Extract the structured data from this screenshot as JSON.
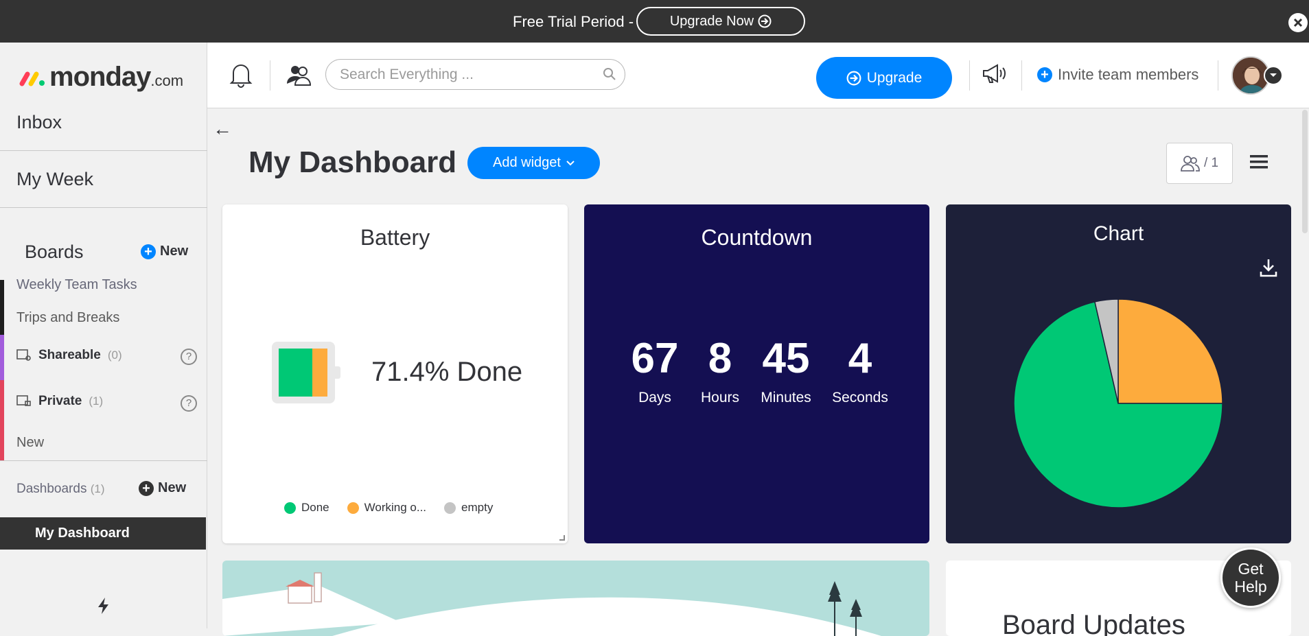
{
  "banner": {
    "text": "Free Trial Period -",
    "upgrade_now_label": "Upgrade Now"
  },
  "sidebar": {
    "logo_text": "monday",
    "logo_suffix": ".com",
    "nav": [
      {
        "label": "Inbox"
      },
      {
        "label": "My Week"
      }
    ],
    "boards_heading": "Boards",
    "boards_new_label": "New",
    "boards": [
      {
        "label": "Weekly Team Tasks"
      },
      {
        "label": "Trips and Breaks"
      }
    ],
    "groups": [
      {
        "label": "Shareable",
        "count": "(0)",
        "help": "?"
      },
      {
        "label": "Private",
        "count": "(1)",
        "help": "?"
      }
    ],
    "new_item_label": "New",
    "dashboards_heading": "Dashboards",
    "dashboards_count": "(1)",
    "dashboards_new_label": "New",
    "dashboards": [
      {
        "label": "My Dashboard"
      }
    ]
  },
  "header": {
    "search_placeholder": "Search Everything ...",
    "upgrade_label": "Upgrade",
    "invite_label": "Invite team members"
  },
  "page": {
    "back_arrow": "←",
    "title": "My Dashboard",
    "add_widget_label": "Add widget",
    "viewers_count": "/ 1"
  },
  "widgets": {
    "battery": {
      "title": "Battery",
      "percent_text": "71.4% Done",
      "done_fraction": 0.714,
      "legend": [
        {
          "label": "Done",
          "color": "#00c875"
        },
        {
          "label": "Working o...",
          "color": "#fdab3d"
        },
        {
          "label": "empty",
          "color": "#c4c4c4"
        }
      ]
    },
    "countdown": {
      "title": "Countdown",
      "units": [
        {
          "value": "67",
          "label": "Days"
        },
        {
          "value": "8",
          "label": "Hours"
        },
        {
          "value": "45",
          "label": "Minutes"
        },
        {
          "value": "4",
          "label": "Seconds"
        }
      ]
    },
    "chart": {
      "title": "Chart"
    },
    "board_updates": {
      "title": "Board Updates"
    }
  },
  "chart_data": {
    "type": "pie",
    "title": "Chart",
    "slices": [
      {
        "label": "Working on it",
        "value": 25,
        "color": "#fdab3d"
      },
      {
        "label": "Done",
        "value": 71.4,
        "color": "#00c875"
      },
      {
        "label": "empty",
        "value": 3.6,
        "color": "#c4c4c4"
      }
    ]
  },
  "get_help_label": "Get Help",
  "colors": {
    "accent": "#0085ff",
    "banner_bg": "#333333",
    "countdown_bg": "#140f52",
    "chart_bg": "#1d2039"
  }
}
